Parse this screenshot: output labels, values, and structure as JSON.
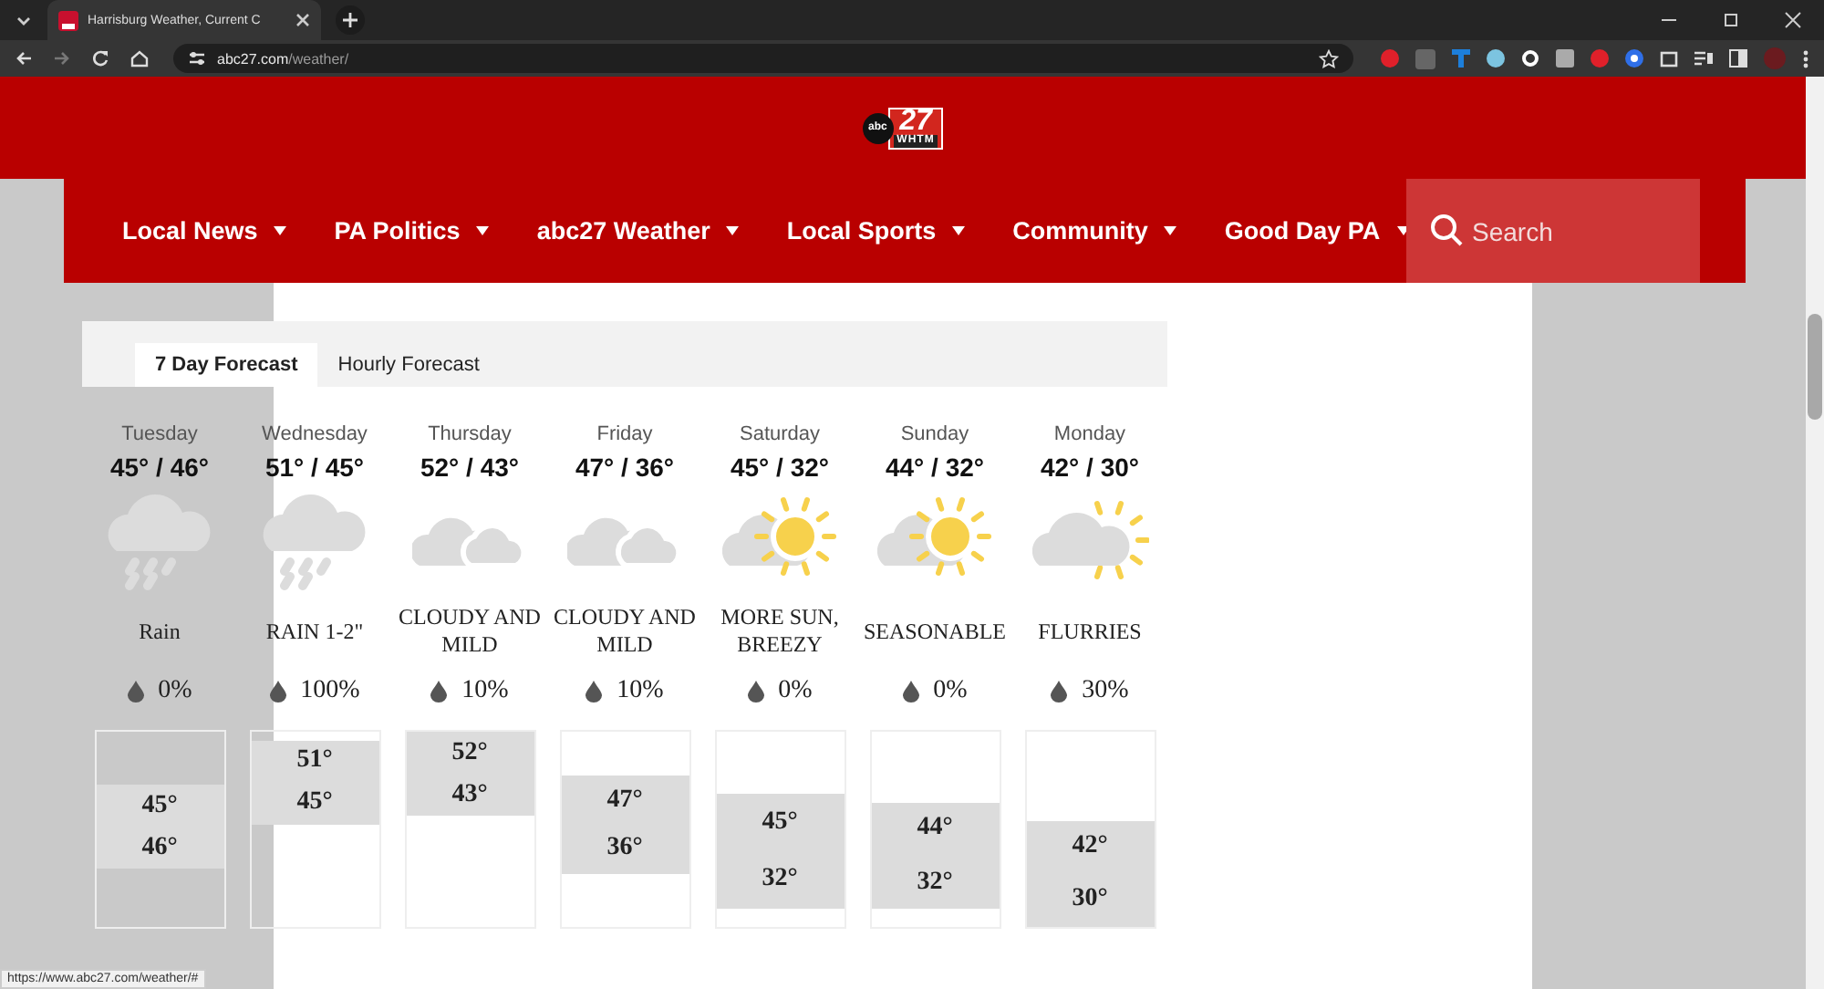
{
  "browser": {
    "tab_title": "Harrisburg Weather, Current C",
    "url_domain": "abc27.com",
    "url_path": "/weather/",
    "status_url": "https://www.abc27.com/weather/#"
  },
  "nav": {
    "items": [
      {
        "label": "Local News"
      },
      {
        "label": "PA Politics"
      },
      {
        "label": "abc27 Weather"
      },
      {
        "label": "Local Sports"
      },
      {
        "label": "Community"
      },
      {
        "label": "Good Day PA"
      }
    ],
    "search": {
      "placeholder": "Search"
    }
  },
  "logo": {
    "number": "27",
    "call_sign": "WHTM",
    "network": "abc"
  },
  "forecast": {
    "tabs": [
      {
        "label": "7 Day Forecast",
        "selected": true
      },
      {
        "label": "Hourly Forecast",
        "selected": false
      }
    ],
    "days": [
      {
        "day": "Tuesday",
        "temps": "45° / 46°",
        "kind": "rain",
        "summary": "Rain",
        "precip": "0%",
        "high": "45°",
        "low": "46°"
      },
      {
        "day": "Wednesday",
        "temps": "51° / 45°",
        "kind": "rain",
        "summary": "RAIN 1-2\"",
        "precip": "100%",
        "high": "51°",
        "low": "45°"
      },
      {
        "day": "Thursday",
        "temps": "52° / 43°",
        "kind": "cloudy",
        "summary": "CLOUDY AND MILD",
        "precip": "10%",
        "high": "52°",
        "low": "43°"
      },
      {
        "day": "Friday",
        "temps": "47° / 36°",
        "kind": "cloudy",
        "summary": "CLOUDY AND MILD",
        "precip": "10%",
        "high": "47°",
        "low": "36°"
      },
      {
        "day": "Saturday",
        "temps": "45° / 32°",
        "kind": "sun_cloud",
        "summary": "MORE SUN, BREEZY",
        "precip": "0%",
        "high": "45°",
        "low": "32°"
      },
      {
        "day": "Sunday",
        "temps": "44° / 32°",
        "kind": "sun_cloud",
        "summary": "SEASONABLE",
        "precip": "0%",
        "high": "44°",
        "low": "32°"
      },
      {
        "day": "Monday",
        "temps": "42° / 30°",
        "kind": "cloud_sun",
        "summary": "FLURRIES",
        "precip": "30%",
        "high": "42°",
        "low": "30°"
      }
    ]
  }
}
